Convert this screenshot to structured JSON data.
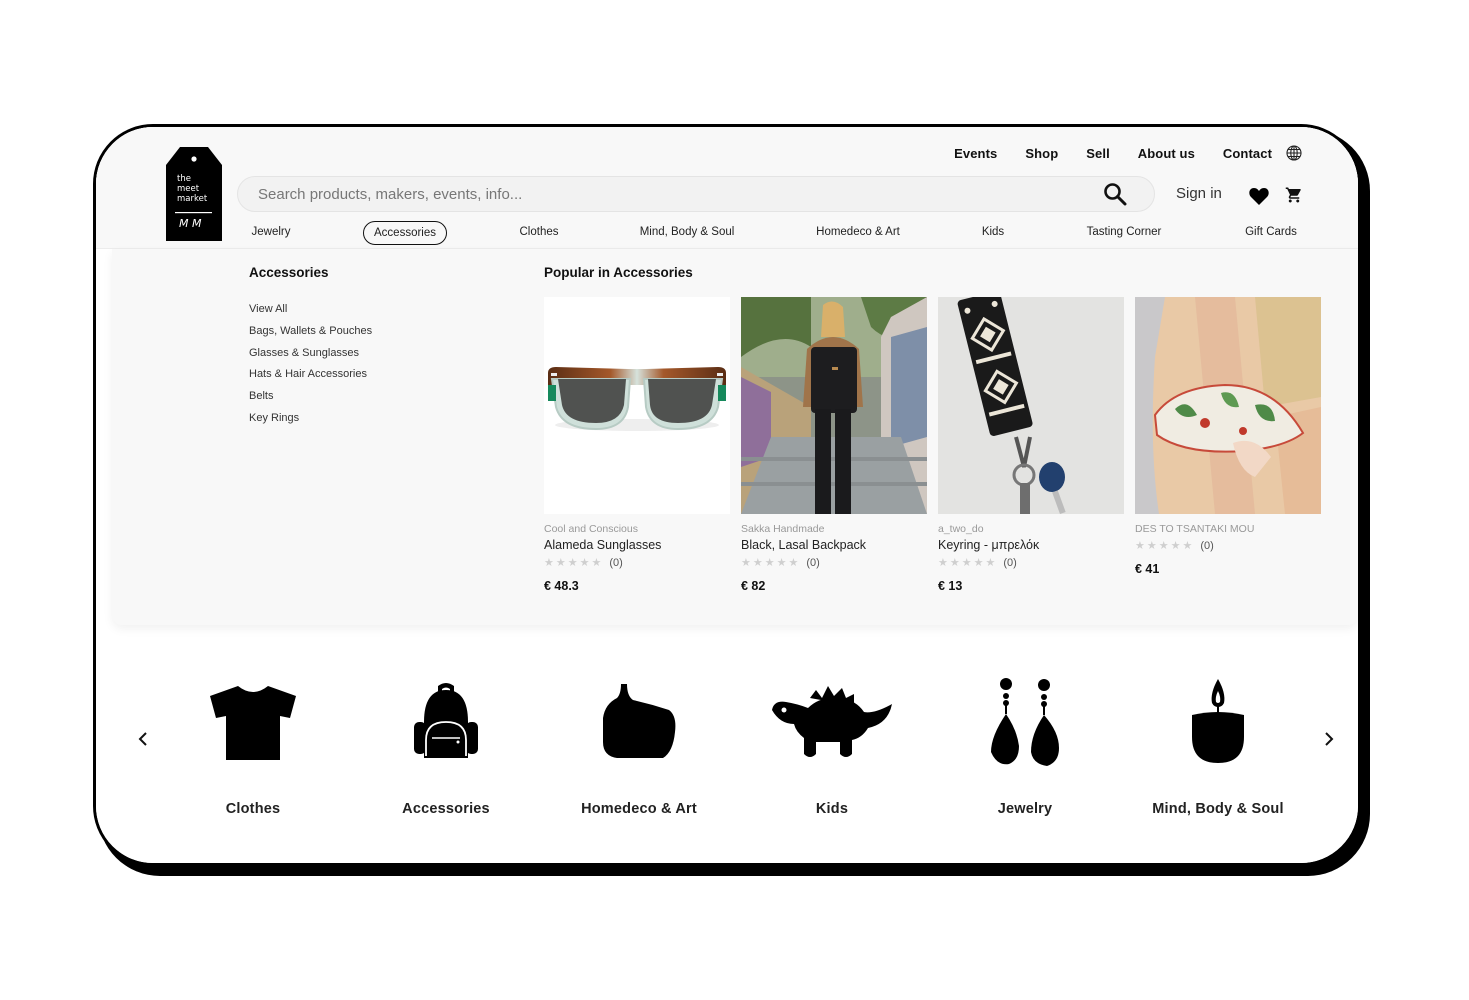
{
  "brand": {
    "logo_lines": [
      "the",
      "meet",
      "market"
    ],
    "logo_mark": "M M"
  },
  "topnav": {
    "items": [
      "Events",
      "Shop",
      "Sell",
      "About us",
      "Contact"
    ],
    "language_icon": "globe-icon"
  },
  "search": {
    "placeholder": "Search products, makers, events, info...",
    "value": "",
    "icon": "search-icon"
  },
  "account": {
    "signin_label": "Sign in",
    "wishlist_icon": "heart-icon",
    "cart_icon": "cart-icon"
  },
  "category_nav": {
    "active": "Accessories",
    "items": [
      "Jewelry",
      "Accessories",
      "Clothes",
      "Mind, Body & Soul",
      "Homedeco & Art",
      "Kids",
      "Tasting Corner",
      "Gift Cards"
    ]
  },
  "dropdown": {
    "title": "Accessories",
    "links": [
      "View All",
      "Bags, Wallets & Pouches",
      "Glasses & Sunglasses",
      "Hats & Hair Accessories",
      "Belts",
      "Key Rings"
    ],
    "popular_title": "Popular in Accessories",
    "products": [
      {
        "maker": "Cool and Conscious",
        "name": "Alameda Sunglasses",
        "rating": 0,
        "stars_max": 5,
        "review_count": "(0)",
        "price": "€ 48.3",
        "image": "sunglasses"
      },
      {
        "maker": "Sakka Handmade",
        "name": "Black, Lasal Backpack",
        "rating": 0,
        "stars_max": 5,
        "review_count": "(0)",
        "price": "€ 82",
        "image": "backpack-photo"
      },
      {
        "maker": "a_two_do",
        "name": "Keyring - μπρελόκ",
        "rating": 0,
        "stars_max": 5,
        "review_count": "(0)",
        "price": "€ 13",
        "image": "keyring-photo"
      },
      {
        "maker": "DES TO TSANTAKI MOU",
        "name": "",
        "rating": 0,
        "stars_max": 5,
        "review_count": "(0)",
        "price": "€ 41",
        "image": "pouch-photo"
      }
    ]
  },
  "carousel": {
    "prev_icon": "chevron-left-icon",
    "next_icon": "chevron-right-icon",
    "categories": [
      {
        "label": "Clothes",
        "icon": "tshirt-icon"
      },
      {
        "label": "Accessories",
        "icon": "backpack-icon"
      },
      {
        "label": "Homedeco & Art",
        "icon": "vase-icon"
      },
      {
        "label": "Kids",
        "icon": "dinosaur-icon"
      },
      {
        "label": "Jewelry",
        "icon": "earrings-icon"
      },
      {
        "label": "Mind, Body & Soul",
        "icon": "candle-icon"
      }
    ]
  },
  "colors": {
    "header_bg": "#f8f8f8",
    "frame": "#000000",
    "text": "#111111",
    "muted": "#999999",
    "star_empty": "#cfcfcf"
  }
}
